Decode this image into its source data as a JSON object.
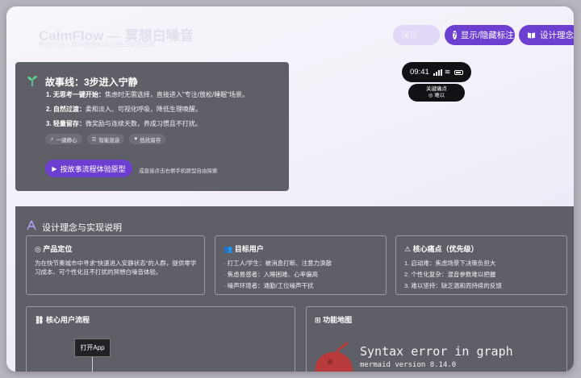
{
  "header": {
    "title": "CalmFlow — 冥想白噪音",
    "subtitle": "帮助忙碌人群快速放松的冥想白噪音应用",
    "ghost_label": "演示",
    "toggle_label": "显示/隐藏标注",
    "concept_label": "设计理念"
  },
  "story": {
    "title": "故事线：3步进入宁静",
    "steps": [
      {
        "lead": "1. 无思考一键开始：",
        "text": "焦虑时无需选择，直接进入\"专注/放松/睡眠\"场景。"
      },
      {
        "lead": "2. 自然过渡：",
        "text": "柔和淡入、可视化呼吸，降低生理唤醒。"
      },
      {
        "lead": "3. 轻量留存：",
        "text": "微奖励与连续天数，养成习惯且不打扰。"
      }
    ],
    "tags": [
      {
        "icon": "bolt-icon",
        "label": "一键静心"
      },
      {
        "icon": "sliders-icon",
        "label": "智能混音"
      },
      {
        "icon": "heart-icon",
        "label": "低扰留存"
      }
    ],
    "play_label": "按故事流程体验原型",
    "hint": "或直接点击右侧手机原型自由探索"
  },
  "phone": {
    "time": "09:41",
    "annotation_line1": "关键痛点",
    "annotation_line2": "难以"
  },
  "section": {
    "title": "设计理念与实现说明",
    "positioning": {
      "title": "产品定位",
      "text": "为在快节奏城市中寻求\"快速进入安静状态\"的人群，提供零学习成本、可个性化且不打扰的冥想白噪音体验。"
    },
    "users": {
      "title": "目标用户",
      "items": [
        "· 打工人/学生：被消息打断、注意力涣散",
        "· 焦虑易感者：入睡困难、心率偏高",
        "· 噪声环境者：通勤/工位噪声干扰"
      ]
    },
    "pain": {
      "title": "核心痛点（优先级）",
      "items": [
        "1. 启动难：焦虑场景下决策负担大",
        "2. 个性化复杂：混音参数难以把握",
        "3. 难以坚持：缺乏温和而持续的反馈"
      ]
    },
    "flow": {
      "title": "核心用户流程",
      "node": "打开App"
    },
    "map": {
      "title": "功能地图",
      "error_title": "Syntax error in graph",
      "error_version": "mermaid version 8.14.0"
    }
  },
  "colors": {
    "accent": "#6d3fd1",
    "card": "#5f5f68"
  }
}
